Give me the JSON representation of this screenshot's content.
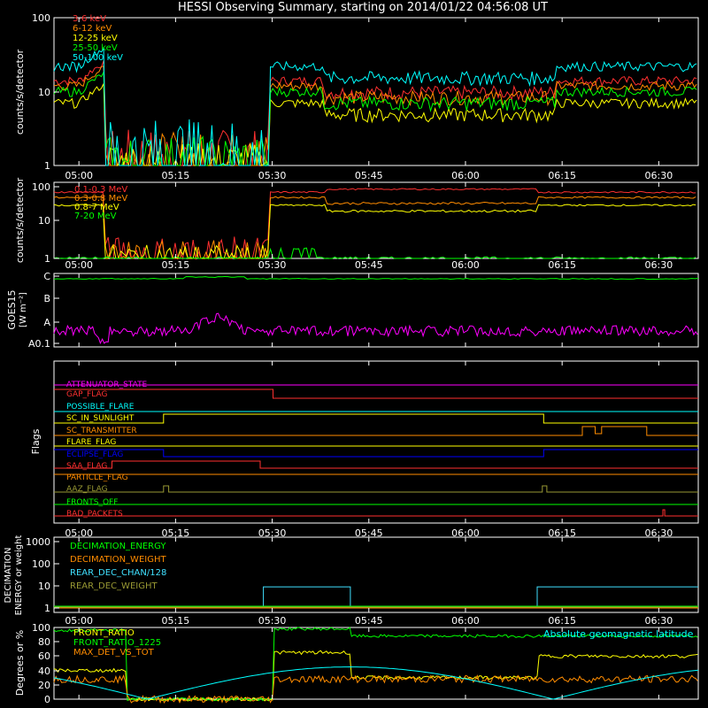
{
  "title": "HESSI Observing Summary, starting on 2014/01/22 04:56:08 UT",
  "time_ticks": [
    "05:00",
    "05:15",
    "05:30",
    "05:45",
    "06:00",
    "06:15",
    "06:30"
  ],
  "colors": {
    "red": "#ff3030",
    "orange": "#ff8c00",
    "yellow": "#ffff00",
    "green": "#00ff00",
    "cyan": "#00ffff",
    "magenta": "#ff00ff",
    "blue": "#0000ff",
    "olive": "#999933",
    "white": "#ffffff",
    "lightcyan": "#40e0ff",
    "axis": "#ffffff"
  },
  "chart_data": [
    {
      "id": "rates-low",
      "type": "line",
      "ylabel": "counts/s/detector",
      "yscale": "log",
      "ylim": [
        1,
        100
      ],
      "yticks": [
        "1",
        "10",
        "100"
      ],
      "legend_placement": "top-left",
      "series": [
        {
          "name": "3-6 keV",
          "color": "red"
        },
        {
          "name": "6-12 keV",
          "color": "orange"
        },
        {
          "name": "12-25 keV",
          "color": "yellow"
        },
        {
          "name": "25-50 keV",
          "color": "green"
        },
        {
          "name": "50-100 keV",
          "color": "cyan"
        }
      ]
    },
    {
      "id": "rates-high",
      "type": "line",
      "ylabel": "counts/s/detector",
      "yscale": "log",
      "ylim": [
        1,
        100
      ],
      "yticks": [
        "1",
        "10",
        "100"
      ],
      "legend_placement": "top-left",
      "series": [
        {
          "name": "0.1-0.3 MeV",
          "color": "red"
        },
        {
          "name": "0.3-0.8 MeV",
          "color": "orange"
        },
        {
          "name": "0.8-7 MeV",
          "color": "yellow"
        },
        {
          "name": "7-20 MeV",
          "color": "green"
        }
      ]
    },
    {
      "id": "goes",
      "type": "line",
      "ylabel": "GOES15",
      "ylabel2": "[W m⁻²]",
      "yticks": [
        "A0.1",
        "A",
        "B",
        "C"
      ],
      "series": [
        {
          "name": "",
          "color": "green"
        },
        {
          "name": "",
          "color": "magenta"
        }
      ]
    },
    {
      "id": "flags",
      "type": "line",
      "ylabel": "Flags",
      "series": [
        {
          "name": "ATTENUATOR_STATE",
          "color": "magenta"
        },
        {
          "name": "GAP_FLAG",
          "color": "red"
        },
        {
          "name": "POSSIBLE_FLARE",
          "color": "cyan"
        },
        {
          "name": "SC_IN_SUNLIGHT",
          "color": "yellow"
        },
        {
          "name": "SC_TRANSMITTER",
          "color": "orange"
        },
        {
          "name": "FLARE_FLAG",
          "color": "yellow"
        },
        {
          "name": "ECLIPSE_FLAG",
          "color": "blue"
        },
        {
          "name": "SAA_FLAG",
          "color": "red"
        },
        {
          "name": "PARTICLE_FLAG",
          "color": "orange"
        },
        {
          "name": "AAZ_FLAG",
          "color": "olive"
        },
        {
          "name": "FRONTS_OFF",
          "color": "green"
        },
        {
          "name": "BAD_PACKETS",
          "color": "red"
        }
      ]
    },
    {
      "id": "decimation",
      "type": "line",
      "ylabel": "DECIMATION",
      "ylabel2": "ENERGY or weight",
      "yscale": "log",
      "yticks": [
        "1",
        "10",
        "100",
        "1000"
      ],
      "series": [
        {
          "name": "DECIMATION_ENERGY",
          "color": "green"
        },
        {
          "name": "DECIMATION_WEIGHT",
          "color": "orange"
        },
        {
          "name": "REAR_DEC_CHAN/128",
          "color": "lightcyan"
        },
        {
          "name": "REAR_DEC_WEIGHT",
          "color": "olive"
        }
      ]
    },
    {
      "id": "ratios",
      "type": "line",
      "ylabel": "Degrees or %",
      "ylim": [
        0,
        100
      ],
      "yticks": [
        "0",
        "20",
        "40",
        "60",
        "80",
        "100"
      ],
      "series": [
        {
          "name": "FRONT_RATIO",
          "color": "yellow"
        },
        {
          "name": "FRONT_RATIO_1225",
          "color": "green"
        },
        {
          "name": "MAX_DET_VS_TOT",
          "color": "orange"
        },
        {
          "name": "Absolute geomagnetic latitude",
          "color": "cyan"
        }
      ]
    }
  ]
}
